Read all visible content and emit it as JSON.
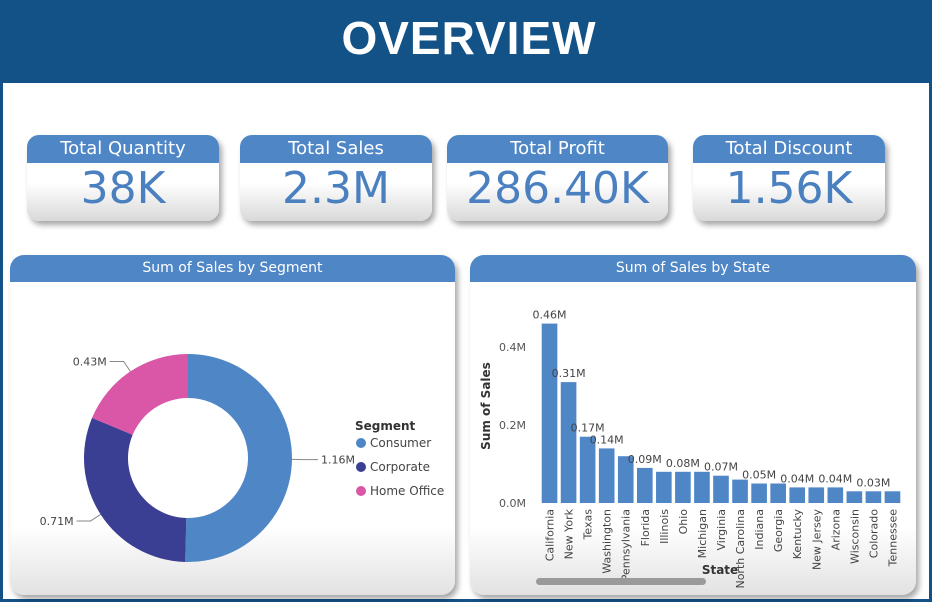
{
  "header": {
    "title": "OVERVIEW"
  },
  "kpis": [
    {
      "label": "Total Quantity",
      "value": "38K"
    },
    {
      "label": "Total Sales",
      "value": "2.3M"
    },
    {
      "label": "Total Profit",
      "value": "286.40K"
    },
    {
      "label": "Total Discount",
      "value": "1.56K"
    }
  ],
  "colors": {
    "header": "#135286",
    "accent": "#4f86c6",
    "consumer": "#4f86c6",
    "corporate": "#3b3f94",
    "home_office": "#d957a6",
    "bar": "#4f86c6"
  },
  "chart_data": [
    {
      "type": "pie",
      "title": "Sum of Sales by Segment",
      "legend_title": "Segment",
      "legend_position": "right",
      "categories": [
        "Consumer",
        "Corporate",
        "Home Office"
      ],
      "values": [
        1.16,
        0.71,
        0.43
      ],
      "data_labels": [
        "1.16M",
        "0.71M",
        "0.43M"
      ],
      "colors": [
        "#4f86c6",
        "#3b3f94",
        "#d957a6"
      ]
    },
    {
      "type": "bar",
      "title": "Sum of Sales by State",
      "xlabel": "State",
      "ylabel": "Sum of Sales",
      "ylim": [
        0,
        0.5
      ],
      "yticks": [
        {
          "value": 0,
          "label": "0.0M"
        },
        {
          "value": 0.2,
          "label": "0.2M"
        },
        {
          "value": 0.4,
          "label": "0.4M"
        }
      ],
      "categories": [
        "California",
        "New York",
        "Texas",
        "Washington",
        "Pennsylvania",
        "Florida",
        "Illinois",
        "Ohio",
        "Michigan",
        "Virginia",
        "North Carolina",
        "Indiana",
        "Georgia",
        "Kentucky",
        "New Jersey",
        "Arizona",
        "Wisconsin",
        "Colorado",
        "Tennessee"
      ],
      "values": [
        0.46,
        0.31,
        0.17,
        0.14,
        0.12,
        0.09,
        0.08,
        0.08,
        0.08,
        0.07,
        0.06,
        0.05,
        0.05,
        0.04,
        0.04,
        0.04,
        0.03,
        0.03,
        0.03
      ],
      "data_labels": [
        "0.46M",
        "0.31M",
        "0.17M",
        "0.14M",
        "",
        "0.09M",
        "",
        "0.08M",
        "",
        "0.07M",
        "",
        "0.05M",
        "",
        "0.04M",
        "",
        "0.04M",
        "",
        "0.03M",
        ""
      ]
    }
  ]
}
